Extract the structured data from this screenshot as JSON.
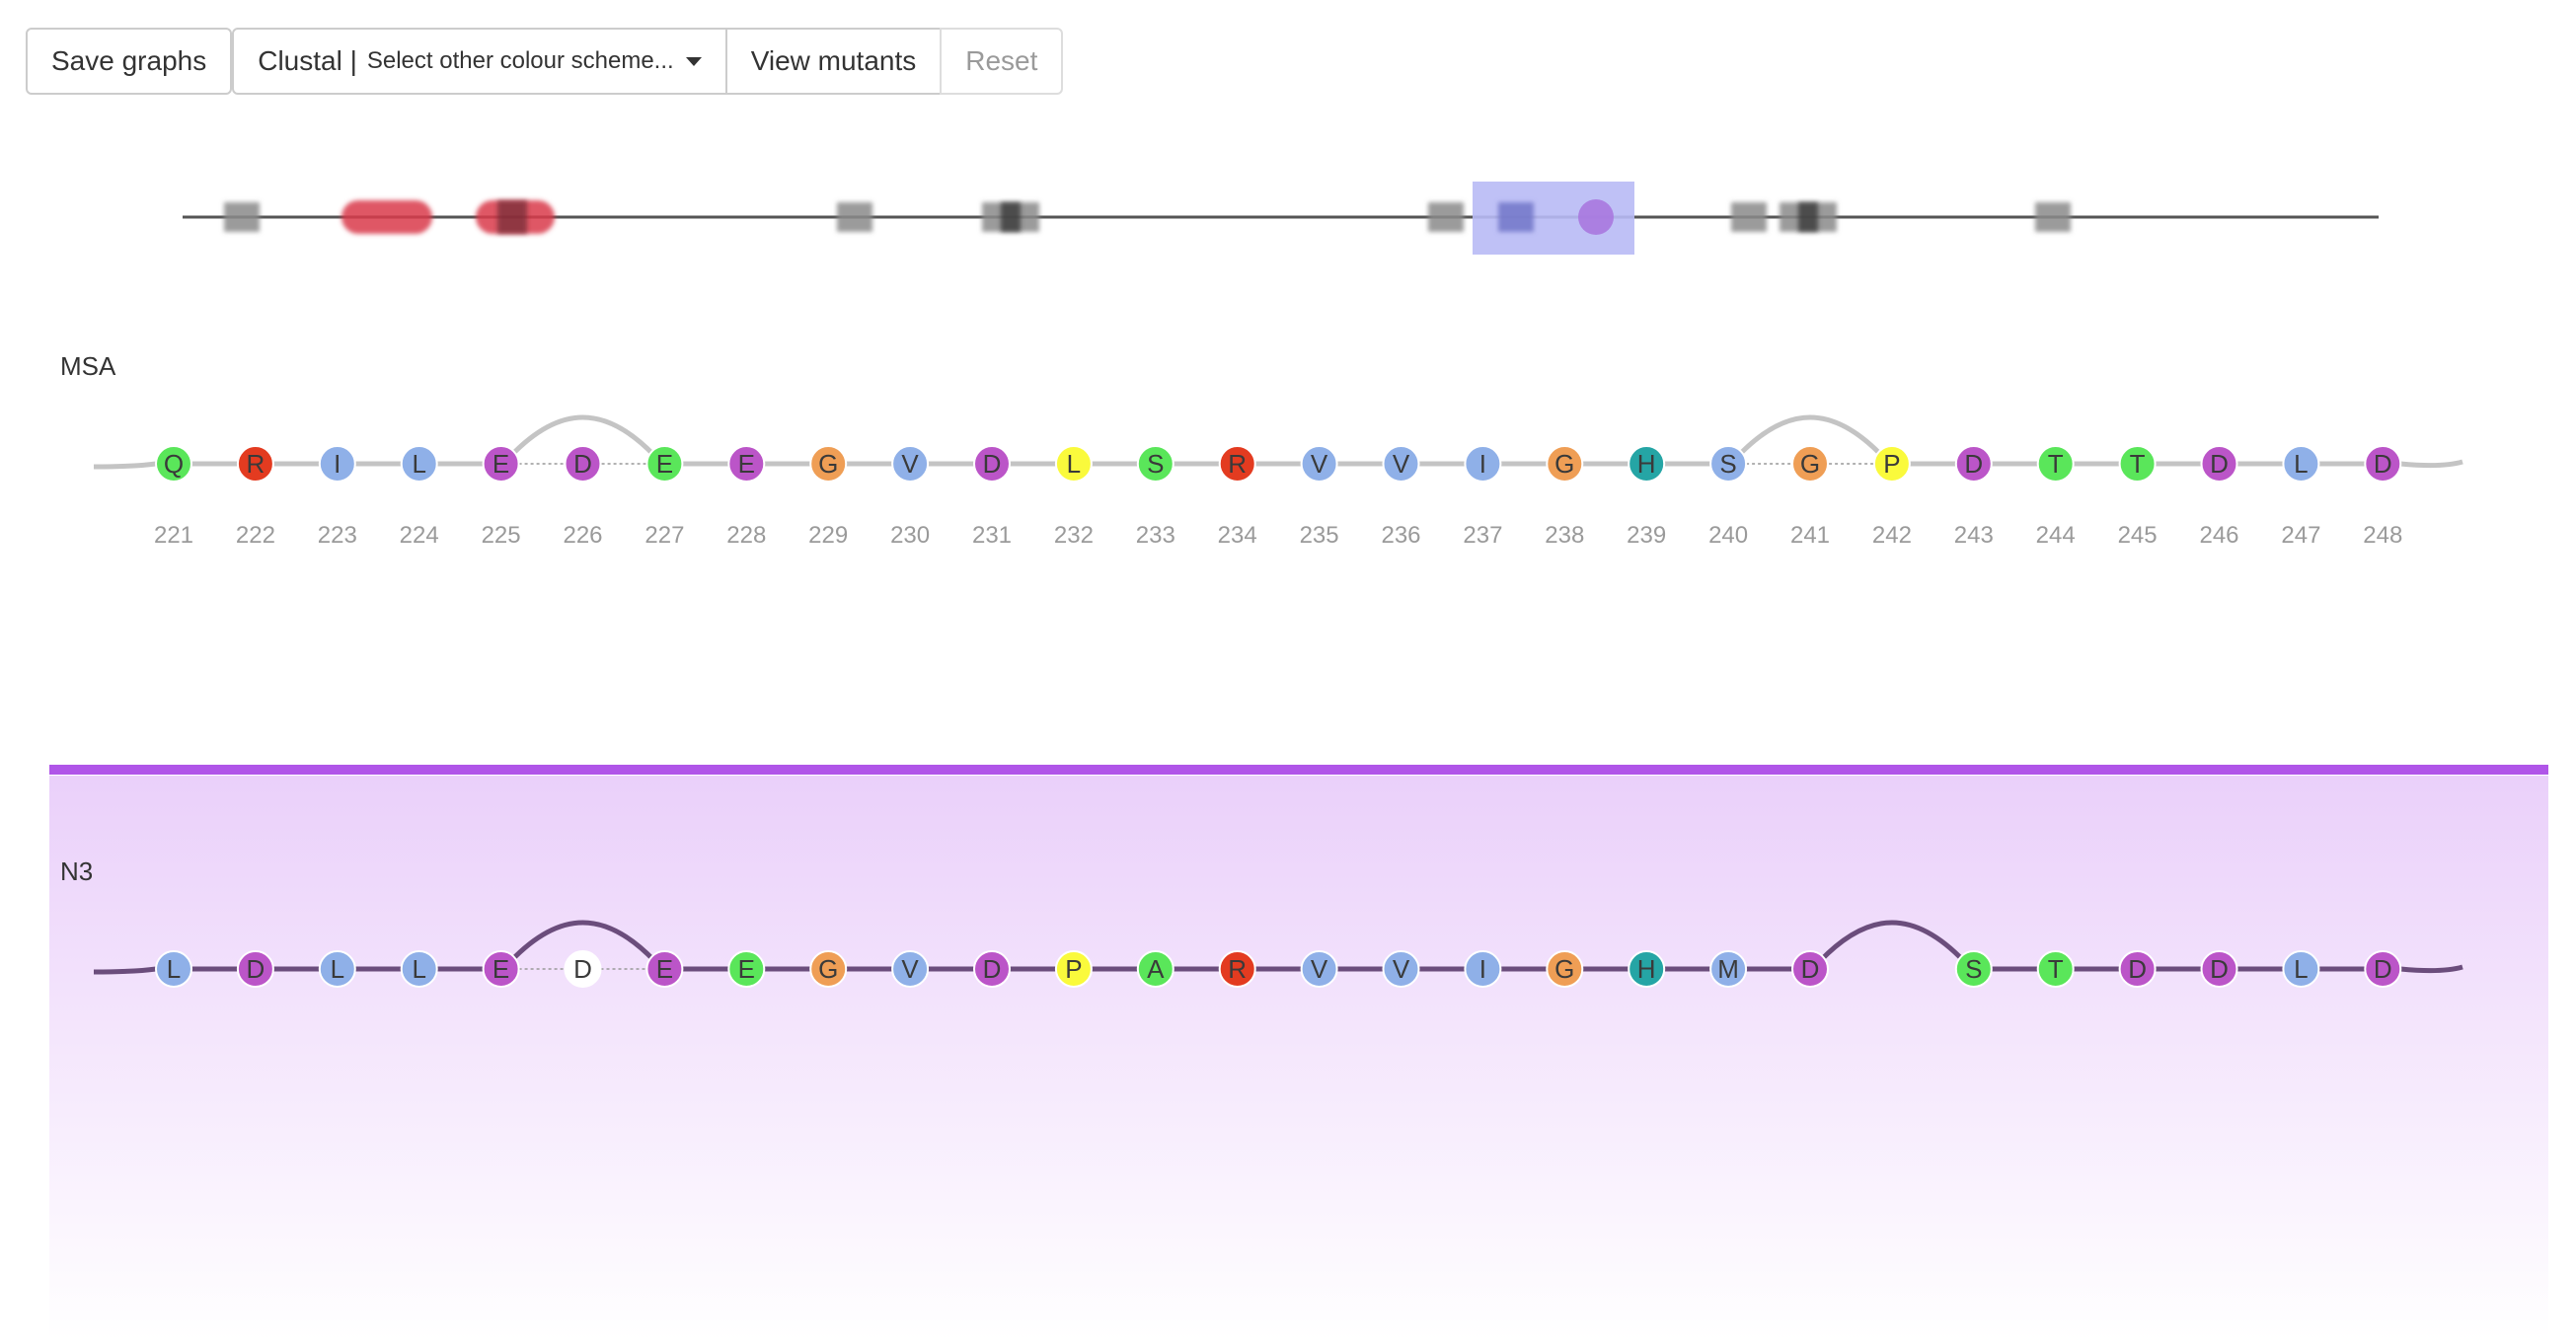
{
  "toolbar": {
    "save_label": "Save graphs",
    "scheme_label": "Clustal |",
    "scheme_dropdown_label": "Select other colour scheme...",
    "mutants_label": "View mutants",
    "reset_label": "Reset"
  },
  "colors": {
    "hydrophobic": "#8fb0e8",
    "positive": "#e33b20",
    "negative": "#bb55c8",
    "polar": "#5ae65a",
    "glycine": "#ef9e55",
    "proline": "#fafa3c",
    "aromatic": "#25a5a5",
    "selection": "#b8baf5",
    "msa_line": "#c4c4c4",
    "n3_line": "#6b4d7c",
    "panel_border": "#b055e8"
  },
  "overview": {
    "markers": [
      "gray",
      "red",
      "red",
      "gray",
      "gray",
      "gray",
      "blue",
      "purple",
      "gray",
      "gray",
      "gray"
    ]
  },
  "msa": {
    "label": "MSA",
    "residues": [
      {
        "aa": "Q",
        "pos": "221",
        "color": "polar"
      },
      {
        "aa": "R",
        "pos": "222",
        "color": "positive"
      },
      {
        "aa": "I",
        "pos": "223",
        "color": "hydrophobic"
      },
      {
        "aa": "L",
        "pos": "224",
        "color": "hydrophobic"
      },
      {
        "aa": "E",
        "pos": "225",
        "color": "negative"
      },
      {
        "aa": "D",
        "pos": "226",
        "color": "negative"
      },
      {
        "aa": "E",
        "pos": "227",
        "color": "polar"
      },
      {
        "aa": "E",
        "pos": "228",
        "color": "negative"
      },
      {
        "aa": "G",
        "pos": "229",
        "color": "glycine"
      },
      {
        "aa": "V",
        "pos": "230",
        "color": "hydrophobic"
      },
      {
        "aa": "D",
        "pos": "231",
        "color": "negative"
      },
      {
        "aa": "L",
        "pos": "232",
        "color": "proline"
      },
      {
        "aa": "S",
        "pos": "233",
        "color": "polar"
      },
      {
        "aa": "R",
        "pos": "234",
        "color": "positive"
      },
      {
        "aa": "V",
        "pos": "235",
        "color": "hydrophobic"
      },
      {
        "aa": "V",
        "pos": "236",
        "color": "hydrophobic"
      },
      {
        "aa": "I",
        "pos": "237",
        "color": "hydrophobic"
      },
      {
        "aa": "G",
        "pos": "238",
        "color": "glycine"
      },
      {
        "aa": "H",
        "pos": "239",
        "color": "aromatic"
      },
      {
        "aa": "S",
        "pos": "240",
        "color": "hydrophobic"
      },
      {
        "aa": "G",
        "pos": "241",
        "color": "glycine"
      },
      {
        "aa": "P",
        "pos": "242",
        "color": "proline"
      },
      {
        "aa": "D",
        "pos": "243",
        "color": "negative"
      },
      {
        "aa": "T",
        "pos": "244",
        "color": "polar"
      },
      {
        "aa": "T",
        "pos": "245",
        "color": "polar"
      },
      {
        "aa": "D",
        "pos": "246",
        "color": "negative"
      },
      {
        "aa": "L",
        "pos": "247",
        "color": "hydrophobic"
      },
      {
        "aa": "D",
        "pos": "248",
        "color": "negative"
      }
    ]
  },
  "n3": {
    "label": "N3",
    "residues": [
      {
        "aa": "L",
        "color": "hydrophobic"
      },
      {
        "aa": "D",
        "color": "negative"
      },
      {
        "aa": "L",
        "color": "hydrophobic"
      },
      {
        "aa": "L",
        "color": "hydrophobic"
      },
      {
        "aa": "E",
        "color": "negative"
      },
      {
        "aa": "D",
        "color": "white"
      },
      {
        "aa": "E",
        "color": "negative"
      },
      {
        "aa": "E",
        "color": "polar"
      },
      {
        "aa": "G",
        "color": "glycine"
      },
      {
        "aa": "V",
        "color": "hydrophobic"
      },
      {
        "aa": "D",
        "color": "negative"
      },
      {
        "aa": "P",
        "color": "proline"
      },
      {
        "aa": "A",
        "color": "polar"
      },
      {
        "aa": "R",
        "color": "positive"
      },
      {
        "aa": "V",
        "color": "hydrophobic"
      },
      {
        "aa": "V",
        "color": "hydrophobic"
      },
      {
        "aa": "I",
        "color": "hydrophobic"
      },
      {
        "aa": "G",
        "color": "glycine"
      },
      {
        "aa": "H",
        "color": "aromatic"
      },
      {
        "aa": "M",
        "color": "hydrophobic"
      },
      {
        "aa": "D",
        "color": "negative"
      },
      {
        "aa": "",
        "color": "gap"
      },
      {
        "aa": "S",
        "color": "polar"
      },
      {
        "aa": "T",
        "color": "polar"
      },
      {
        "aa": "D",
        "color": "negative"
      },
      {
        "aa": "D",
        "color": "negative"
      },
      {
        "aa": "L",
        "color": "hydrophobic"
      },
      {
        "aa": "D",
        "color": "negative"
      }
    ]
  }
}
